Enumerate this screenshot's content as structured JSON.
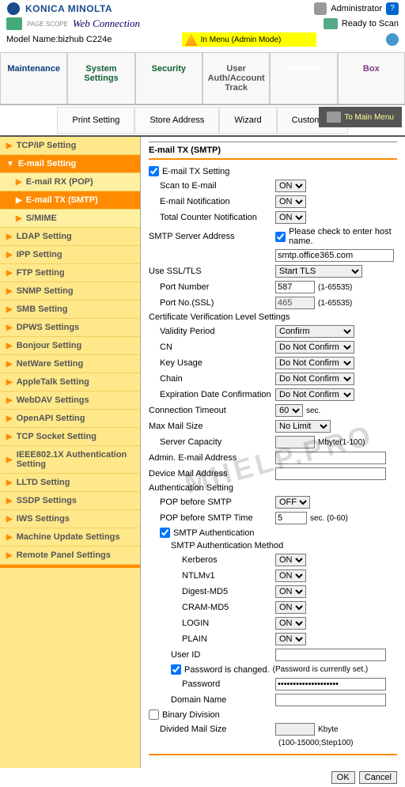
{
  "header": {
    "brand": "KONICA MINOLTA",
    "admin_label": "Administrator",
    "webconn_prefix": "PAGE SCOPE",
    "webconn": "Web Connection",
    "ready": "Ready to Scan",
    "model_label": "Model Name:",
    "model_value": "bizhub C224e",
    "mode_text": "In Menu (Admin Mode)"
  },
  "topnav": {
    "maintenance": "Maintenance",
    "system": "System Settings",
    "security": "Security",
    "user": "User Auth/Account Track",
    "network": "Network",
    "box": "Box"
  },
  "subnav": {
    "print": "Print Setting",
    "store": "Store Address",
    "wizard": "Wizard",
    "customize": "Customize",
    "mainmenu": "To Main Menu"
  },
  "sidebar": [
    {
      "label": "TCP/IP Setting",
      "sel": false
    },
    {
      "label": "E-mail Setting",
      "sel": true,
      "children": [
        {
          "label": "E-mail RX (POP)",
          "sel": false
        },
        {
          "label": "E-mail TX (SMTP)",
          "sel": true
        },
        {
          "label": "S/MIME",
          "sel": false
        }
      ]
    },
    {
      "label": "LDAP Setting"
    },
    {
      "label": "IPP Setting"
    },
    {
      "label": "FTP Setting"
    },
    {
      "label": "SNMP Setting"
    },
    {
      "label": "SMB Setting"
    },
    {
      "label": "DPWS Settings"
    },
    {
      "label": "Bonjour Setting"
    },
    {
      "label": "NetWare Setting"
    },
    {
      "label": "AppleTalk Setting"
    },
    {
      "label": "WebDAV Settings"
    },
    {
      "label": "OpenAPI Setting"
    },
    {
      "label": "TCP Socket Setting"
    },
    {
      "label": "IEEE802.1X Authentication Setting"
    },
    {
      "label": "LLTD Setting"
    },
    {
      "label": "SSDP Settings"
    },
    {
      "label": "IWS Settings"
    },
    {
      "label": "Machine Update Settings"
    },
    {
      "label": "Remote Panel Settings"
    }
  ],
  "form": {
    "title": "E-mail TX (SMTP)",
    "emailTxSetting": "E-mail TX Setting",
    "scanToEmail_lbl": "Scan to E-mail",
    "scanToEmail_val": "ON",
    "emailNotif_lbl": "E-mail Notification",
    "emailNotif_val": "ON",
    "totalCounter_lbl": "Total Counter Notification",
    "totalCounter_val": "ON",
    "smtpAddr_lbl": "SMTP Server Address",
    "hostCheck_lbl": "Please check to enter host name.",
    "smtpAddr_val": "smtp.office365.com",
    "useSSL_lbl": "Use SSL/TLS",
    "useSSL_val": "Start TLS",
    "port_lbl": "Port Number",
    "port_val": "587",
    "port_range": "(1-65535)",
    "portssl_lbl": "Port No.(SSL)",
    "portssl_val": "465",
    "portssl_range": "(1-65535)",
    "certHeader": "Certificate Verification Level Settings",
    "validity_lbl": "Validity Period",
    "validity_val": "Confirm",
    "cn_lbl": "CN",
    "cn_val": "Do Not Confirm",
    "keyusage_lbl": "Key Usage",
    "keyusage_val": "Do Not Confirm",
    "chain_lbl": "Chain",
    "chain_val": "Do Not Confirm",
    "expdate_lbl": "Expiration Date Confirmation",
    "expdate_val": "Do Not Confirm",
    "timeout_lbl": "Connection Timeout",
    "timeout_val": "60",
    "timeout_unit": "sec.",
    "maxmail_lbl": "Max Mail Size",
    "maxmail_val": "No Limit",
    "servercap_lbl": "Server Capacity",
    "servercap_val": "",
    "servercap_unit": "Mbyte(1-100)",
    "adminaddr_lbl": "Admin. E-mail Address",
    "adminaddr_val": "",
    "devaddr_lbl": "Device Mail Address",
    "devaddr_val": "",
    "authHeader": "Authentication Setting",
    "popSmtp_lbl": "POP before SMTP",
    "popSmtp_val": "OFF",
    "popTime_lbl": "POP before SMTP Time",
    "popTime_val": "5",
    "popTime_unit": "sec. (0-60)",
    "smtpAuth_lbl": "SMTP Authentication",
    "smtpMethod_lbl": "SMTP Authentication Method",
    "kerberos_lbl": "Kerberos",
    "kerberos_val": "ON",
    "ntlm_lbl": "NTLMv1",
    "ntlm_val": "ON",
    "digest_lbl": "Digest-MD5",
    "digest_val": "ON",
    "cram_lbl": "CRAM-MD5",
    "cram_val": "ON",
    "login_lbl": "LOGIN",
    "login_val": "ON",
    "plain_lbl": "PLAIN",
    "plain_val": "ON",
    "userid_lbl": "User ID",
    "userid_val": "",
    "pwdChanged_lbl": "Password is changed.",
    "pwdSet_lbl": "(Password is currently set.)",
    "pwd_lbl": "Password",
    "pwd_val": "••••••••••••••••••••",
    "domain_lbl": "Domain Name",
    "domain_val": "",
    "binary_lbl": "Binary Division",
    "divmail_lbl": "Divided Mail Size",
    "divmail_val": "",
    "divmail_unit": "Kbyte",
    "divmail_range": "(100-15000;Step100)"
  },
  "buttons": {
    "ok": "OK",
    "cancel": "Cancel"
  },
  "watermark": "MHELP.PRO"
}
